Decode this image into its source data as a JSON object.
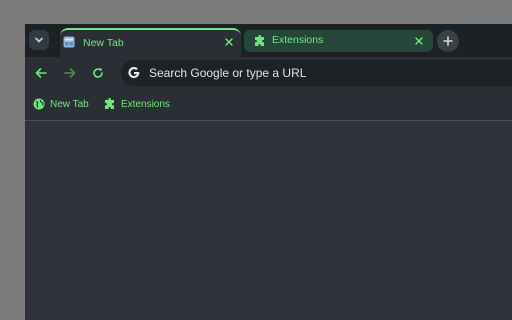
{
  "colors": {
    "accent": "#6fe87a",
    "page_background": "#7b7b7b",
    "tabstrip_background": "#1c2126",
    "toolbar_background": "#2a2f35",
    "content_background": "#2e333a",
    "inactive_tab_background": "#27463a",
    "omnibox_background": "#1d2227"
  },
  "tabstrip": {
    "tab_search_icon": "chevron-down-icon",
    "tabs": [
      {
        "label": "New Tab",
        "icon": "new-tab-favicon",
        "active": true,
        "close_icon": "close-icon"
      },
      {
        "label": "Extensions",
        "icon": "puzzle-piece-icon",
        "active": false,
        "close_icon": "close-icon"
      }
    ],
    "new_tab_icon": "plus-icon"
  },
  "toolbar": {
    "back_icon": "arrow-left-icon",
    "forward_icon": "arrow-right-icon",
    "reload_icon": "reload-icon",
    "omnibox": {
      "icon": "google-g-icon",
      "placeholder": "Search Google or type a URL"
    }
  },
  "bookmarks": [
    {
      "label": "New Tab",
      "icon": "globe-icon"
    },
    {
      "label": "Extensions",
      "icon": "puzzle-piece-icon"
    }
  ]
}
